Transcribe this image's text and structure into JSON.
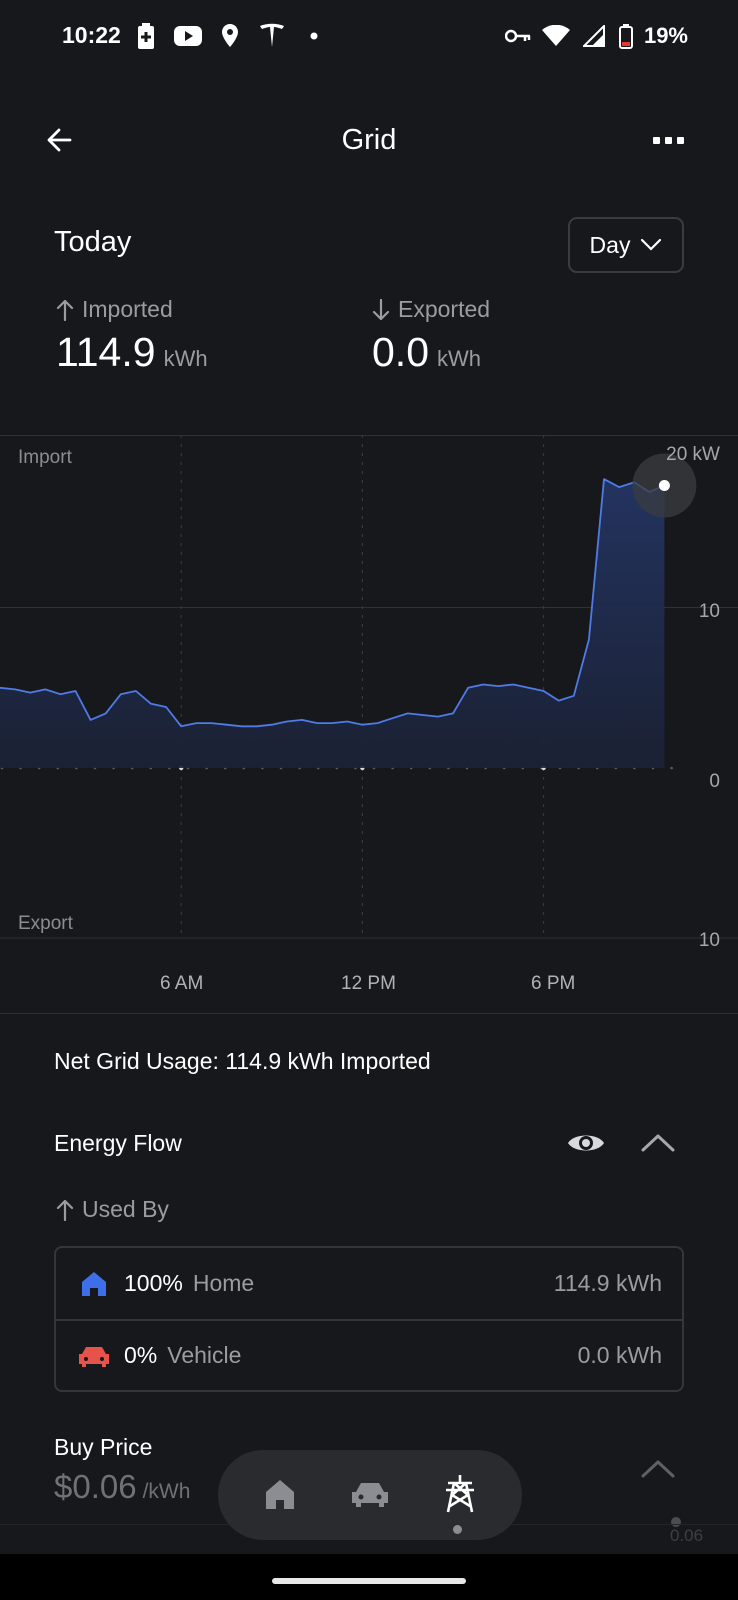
{
  "status_bar": {
    "time": "10:22",
    "battery_percent": "19%",
    "left_icons": [
      "battery-saver-icon",
      "youtube-icon",
      "location-icon",
      "tesla-icon",
      "dot-icon"
    ],
    "right_icons": [
      "vpn-key-icon",
      "wifi-icon",
      "signal-icon",
      "battery-low-icon"
    ]
  },
  "header": {
    "title": "Grid"
  },
  "summary": {
    "period": "Today",
    "range_label": "Day",
    "imported_label": "Imported",
    "imported_value": "114.9",
    "imported_unit": "kWh",
    "exported_label": "Exported",
    "exported_value": "0.0",
    "exported_unit": "kWh"
  },
  "chart_data": {
    "type": "area",
    "top_label": "Import",
    "bottom_label": "Export",
    "y_unit": "kW",
    "y_tick_labels": [
      "20 kW",
      "10",
      "0",
      "10"
    ],
    "x_tick_labels": [
      "6 AM",
      "12 PM",
      "6 PM"
    ],
    "x_hours": [
      0,
      0.5,
      1,
      1.5,
      2,
      2.5,
      3,
      3.5,
      4,
      4.5,
      5,
      5.5,
      6,
      6.5,
      7,
      7.5,
      8,
      8.5,
      9,
      9.5,
      10,
      10.5,
      11,
      11.5,
      12,
      12.5,
      13,
      13.5,
      14,
      14.5,
      15,
      15.5,
      16,
      16.5,
      17,
      17.5,
      18,
      18.5,
      19,
      19.5,
      20,
      20.5,
      21,
      21.5,
      22
    ],
    "import_kw": [
      5.0,
      4.9,
      4.7,
      4.9,
      4.6,
      4.8,
      3.0,
      3.4,
      4.6,
      4.8,
      4.0,
      3.8,
      2.6,
      2.8,
      2.8,
      2.7,
      2.6,
      2.6,
      2.7,
      2.9,
      3.0,
      2.8,
      2.8,
      2.9,
      2.7,
      2.8,
      3.1,
      3.4,
      3.3,
      3.2,
      3.4,
      5.0,
      5.2,
      5.1,
      5.2,
      5.0,
      4.8,
      4.2,
      4.5,
      8.0,
      18.0,
      17.5,
      17.8,
      17.2,
      17.6
    ],
    "ylim": [
      0,
      20
    ],
    "export_ylim": [
      0,
      10
    ],
    "current_value_kw": 17.2
  },
  "net_usage": {
    "text": "Net Grid Usage: 114.9 kWh Imported"
  },
  "energy_flow": {
    "title": "Energy Flow",
    "used_by_label": "Used By",
    "items": [
      {
        "percent": "100%",
        "name": "Home",
        "amount": "114.9 kWh",
        "icon": "home-icon",
        "color": "#3f6fe8"
      },
      {
        "percent": "0%",
        "name": "Vehicle",
        "amount": "0.0 kWh",
        "icon": "car-icon",
        "color": "#e5534b"
      }
    ]
  },
  "buy_price": {
    "title": "Buy Price",
    "value": "$0.06",
    "unit": "/kWh",
    "tick_label": "0.06"
  },
  "bottom_nav": {
    "items": [
      "home-icon",
      "car-icon",
      "grid-tower-icon"
    ],
    "active": "grid-tower-icon"
  },
  "colors": {
    "background": "#17181b",
    "line": "#4f7be8",
    "fill": "#1e2b4a"
  }
}
